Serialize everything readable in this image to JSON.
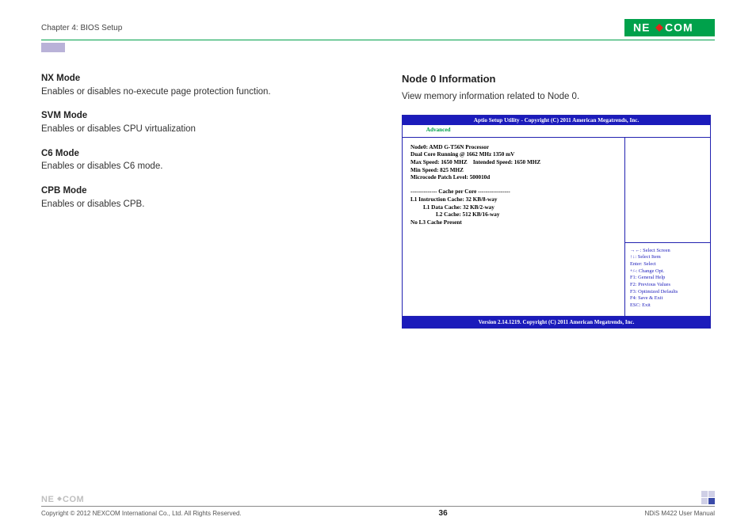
{
  "header": {
    "chapter": "Chapter 4: BIOS Setup"
  },
  "logo": {
    "text": "NEXCOM"
  },
  "left": {
    "nx_mode": {
      "title": "NX Mode",
      "desc": "Enables or disables no-execute page protection function."
    },
    "svm_mode": {
      "title": "SVM Mode",
      "desc": "Enables or disables CPU virtualization"
    },
    "c6_mode": {
      "title": "C6 Mode",
      "desc": "Enables or disables C6 mode."
    },
    "cpb_mode": {
      "title": "CPB Mode",
      "desc": "Enables or disables CPB."
    }
  },
  "right": {
    "heading": "Node 0 Information",
    "desc": "View memory information related to Node 0."
  },
  "bios": {
    "title": "Aptio Setup Utility - Copyright (C) 2011 American Megatrends, Inc.",
    "tab_active": "Advanced",
    "lines": {
      "l1": "Node0: AMD G-T56N Processor",
      "l2": "Dual Core Running @ 1662 MHz 1350 mV",
      "l3": "Max Speed: 1650 MHZ    Intended Speed: 1650 MHZ",
      "l4": "Min Speed: 825 MHZ",
      "l5": "Microcode Patch Level: 500010d",
      "l6": "-------------- Cache per Core -----------------",
      "l7": "L1 Instruction Cache: 32 KB/8-way",
      "l8": "L1 Data Cache: 32 KB/2-way",
      "l9": "L2 Cache: 512 KB/16-way",
      "l10": "No L3 Cache Present"
    },
    "help": {
      "h1": "→←: Select Screen",
      "h2": "↑↓: Select Item",
      "h3": "Enter: Select",
      "h4": "+/-: Change Opt.",
      "h5": "F1: General Help",
      "h6": "F2: Previous Values",
      "h7": "F3: Optimized Defaults",
      "h8": "F4: Save & Exit",
      "h9": "ESC: Exit"
    },
    "footer": "Version 2.14.1219. Copyright (C) 2011 American Megatrends, Inc."
  },
  "footer": {
    "copyright": "Copyright © 2012 NEXCOM International Co., Ltd. All Rights Reserved.",
    "page": "36",
    "manual": "NDiS M422 User Manual"
  }
}
